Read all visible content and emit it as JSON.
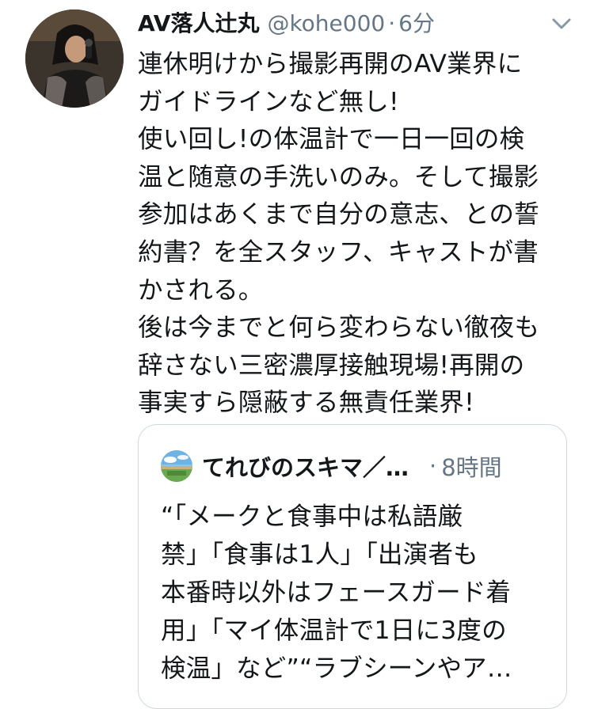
{
  "tweet": {
    "display_name": "AV落人辻丸",
    "handle": "@kohe000",
    "separator": "·",
    "time": "6分",
    "menu_icon": "chevron-down-icon",
    "text_lines": [
      "連休明けから撮影再開のAV業界に",
      "ガイドラインなど無し!",
      "使い回し!の体温計で一日一回の検",
      "温と随意の手洗いのみ。そして撮影",
      "参加はあくまで自分の意志、との誓",
      "約書？を全スタッフ、キャストが書",
      "かされる。",
      "後は今までと何ら変わらない徹夜も",
      "辞さない三密濃厚接触現場!再開の",
      "事実すら隠蔽する無責任業界!"
    ]
  },
  "quote": {
    "display_name": "てれびのスキマ／…",
    "separator": "·",
    "time": "8時間",
    "text_lines": [
      "“「メークと食事中は私語厳",
      "禁」「食事は1人」「出演者も",
      "本番時以外はフェースガード着",
      "用」「マイ体温計で1日に3度の",
      "検温」など”“ラブシーンやア…"
    ]
  },
  "colors": {
    "text": "#14171a",
    "secondary": "#657786",
    "border": "#cfd9de"
  }
}
